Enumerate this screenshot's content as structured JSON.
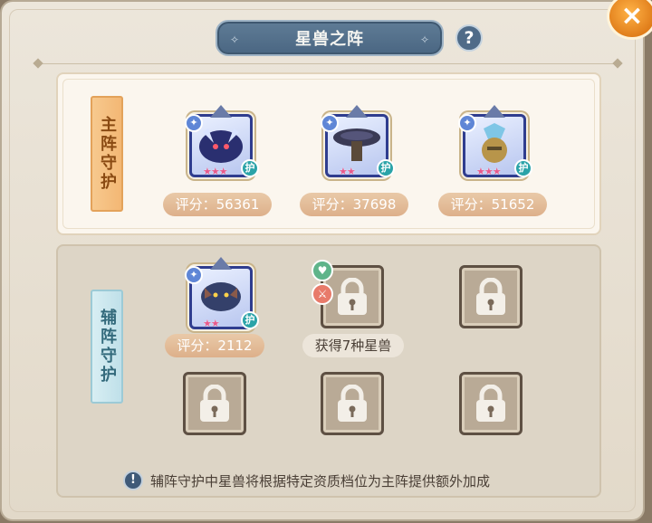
{
  "window": {
    "title": "星兽之阵",
    "help_icon": "?",
    "close_icon": "×"
  },
  "main_formation": {
    "tag": "主阵守护",
    "pets": [
      {
        "score": "评分：56361",
        "stars": "★★★",
        "guard": "护",
        "theme": "#2a2f70"
      },
      {
        "score": "评分：37698",
        "stars": "★★",
        "guard": "护",
        "theme": "#3a3a55"
      },
      {
        "score": "评分：51652",
        "stars": "★★★",
        "guard": "护",
        "theme": "#b8954a"
      }
    ]
  },
  "sub_formation": {
    "tag": "辅阵守护",
    "pet": {
      "score": "评分：2112",
      "stars": "★★",
      "guard": "护",
      "theme": "#34406a"
    },
    "unlock_label": "获得7种星兽",
    "heart_icon": "♥",
    "sword_icon": "⚔"
  },
  "notice": {
    "icon": "!",
    "text": "辅阵守护中星兽将根据特定资质档位为主阵提供额外加成"
  },
  "colors": {
    "accent_orange": "#f3b774",
    "accent_teal": "#bfe0e9",
    "title_blue": "#4a6682"
  }
}
